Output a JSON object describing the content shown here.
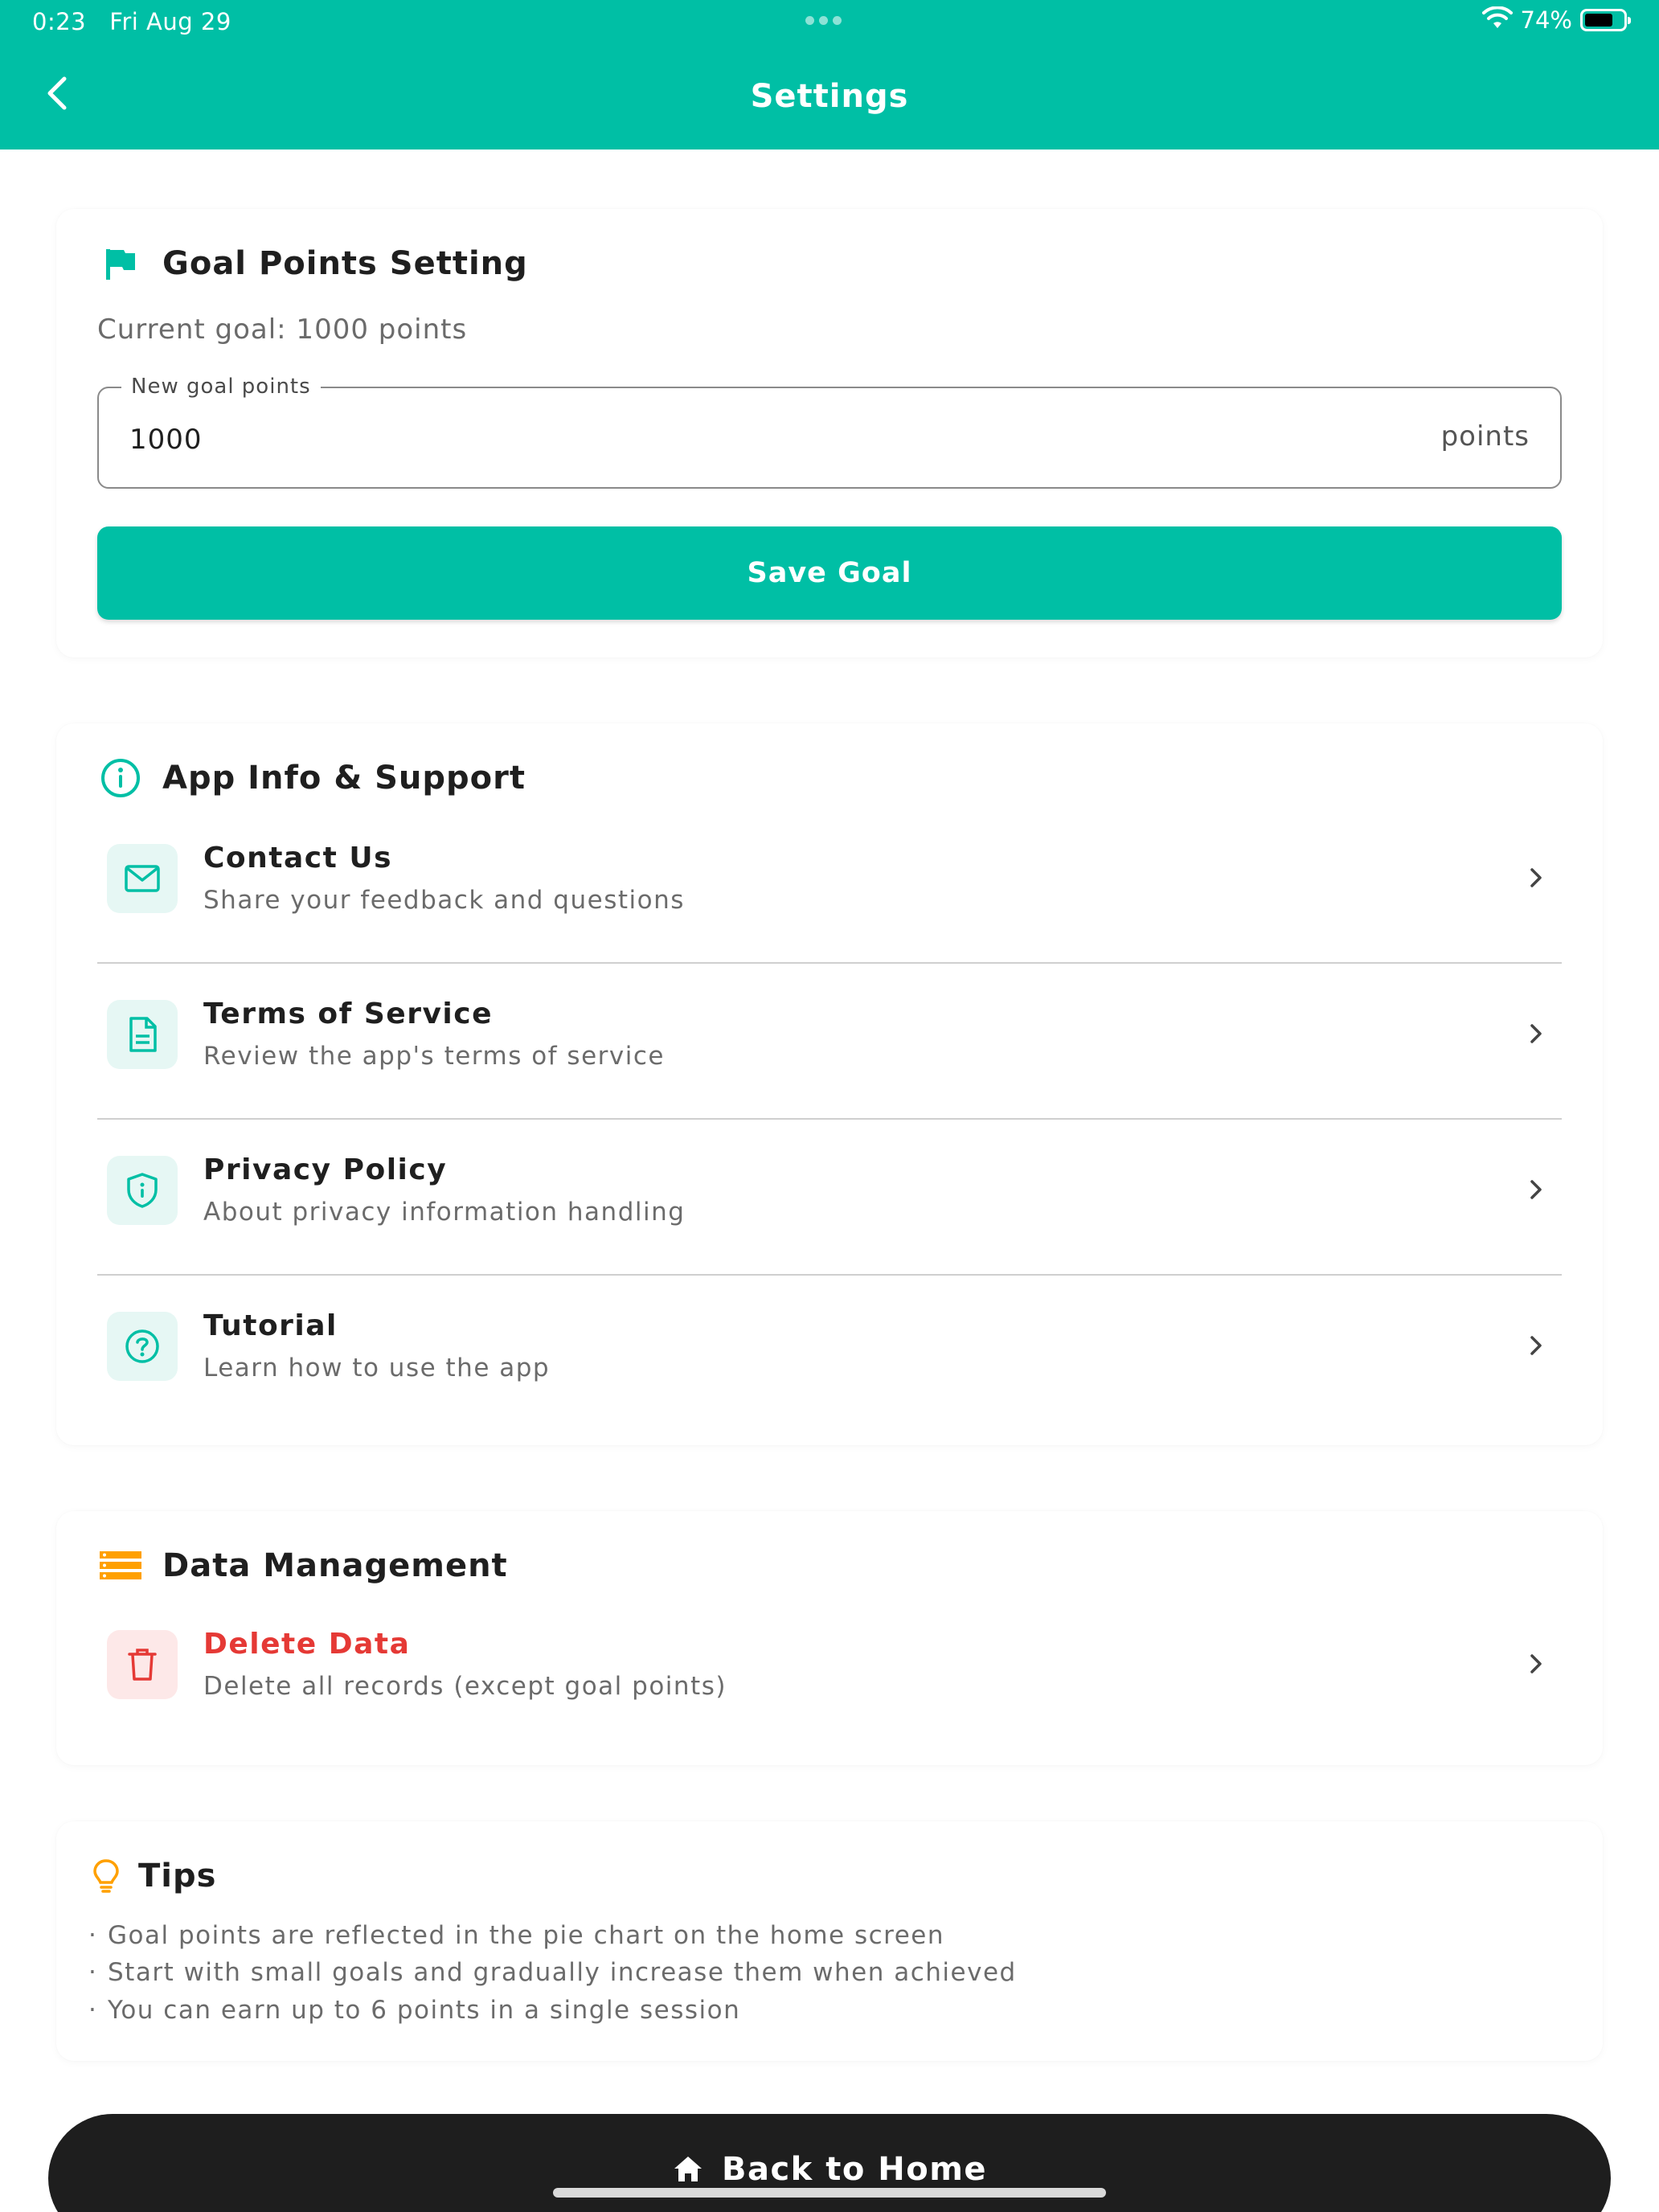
{
  "status_bar": {
    "time": "0:23",
    "date": "Fri Aug 29",
    "battery": "74%",
    "battery_level": 0.74
  },
  "header": {
    "title": "Settings"
  },
  "goal_card": {
    "title": "Goal Points Setting",
    "current_goal": "Current goal: 1000 points",
    "field_label": "New goal points",
    "field_value": "1000",
    "field_suffix": "points",
    "save_label": "Save Goal"
  },
  "info_card": {
    "title": "App Info & Support",
    "items": [
      {
        "title": "Contact Us",
        "subtitle": "Share your feedback and questions",
        "icon": "mail-icon"
      },
      {
        "title": "Terms of Service",
        "subtitle": "Review the app's terms of service",
        "icon": "document-icon"
      },
      {
        "title": "Privacy Policy",
        "subtitle": "About privacy information handling",
        "icon": "shield-icon"
      },
      {
        "title": "Tutorial",
        "subtitle": "Learn how to use the app",
        "icon": "help-circle-icon"
      }
    ]
  },
  "data_card": {
    "title": "Data Management",
    "items": [
      {
        "title": "Delete Data",
        "subtitle": "Delete all records (except goal points)",
        "icon": "trash-icon"
      }
    ]
  },
  "tips": {
    "title": "Tips",
    "items": [
      "Goal points are reflected in the pie chart on the home screen",
      "Start with small goals and gradually increase them when achieved",
      "You can earn up to 6 points in a single session"
    ]
  },
  "bottom": {
    "home_label": "Back to Home"
  },
  "colors": {
    "primary": "#00bfa5",
    "danger": "#e53935",
    "warning": "#ffa000",
    "dark": "#1e1e1e"
  }
}
